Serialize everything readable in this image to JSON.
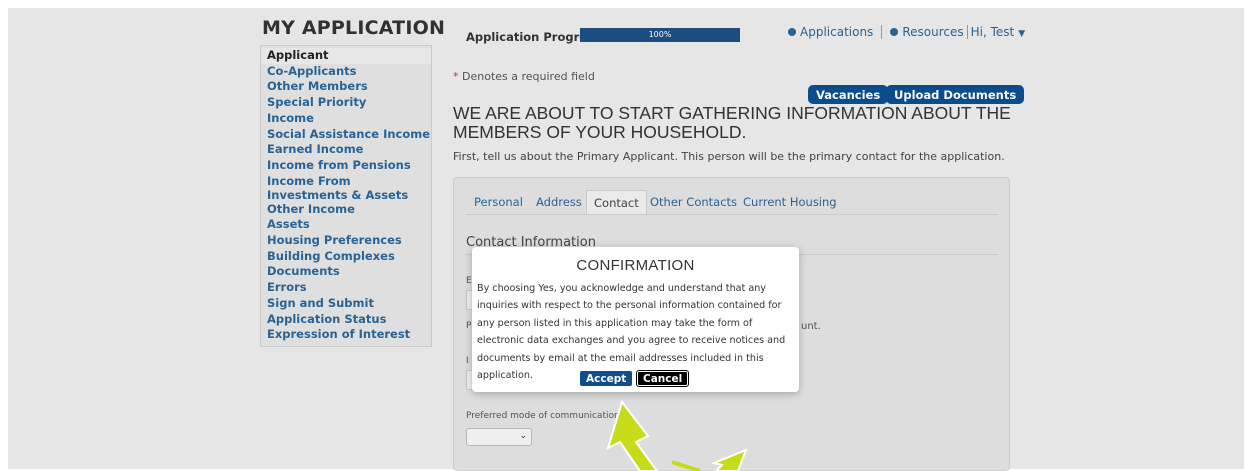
{
  "header": {
    "title": "MY APPLICATION",
    "progress_label": "Application Progress",
    "progress_value": 1.0,
    "progress_text": "100%",
    "nav": {
      "applications": "Applications",
      "resources": "Resources",
      "user": "Hi, Test"
    }
  },
  "sidebar": {
    "items": [
      {
        "label": "Applicant"
      },
      {
        "label": "Co-Applicants"
      },
      {
        "label": "Other Members"
      },
      {
        "label": "Special Priority"
      },
      {
        "label": "Income"
      },
      {
        "label": "Social Assistance Income"
      },
      {
        "label": "Earned Income"
      },
      {
        "label": "Income from Pensions"
      },
      {
        "label": "Income From Investments & Assets"
      },
      {
        "label": "Other Income"
      },
      {
        "label": "Assets"
      },
      {
        "label": "Housing Preferences"
      },
      {
        "label": "Building Complexes"
      },
      {
        "label": "Documents"
      },
      {
        "label": "Errors"
      },
      {
        "label": "Sign and Submit"
      },
      {
        "label": "Application Status"
      },
      {
        "label": "Expression of Interest"
      }
    ]
  },
  "main": {
    "required_star": "*",
    "required_note": "Denotes a required field",
    "vacancies_label": "Vacancies",
    "upload_label": "Upload Documents",
    "heading": "WE ARE ABOUT TO START GATHERING INFORMATION ABOUT THE MEMBERS OF YOUR HOUSEHOLD.",
    "intro": "First, tell us about the Primary Applicant. This person will be the primary contact for the application.",
    "tabs": [
      {
        "label": "Personal"
      },
      {
        "label": "Address"
      },
      {
        "label": "Contact"
      },
      {
        "label": "Other Contacts"
      },
      {
        "label": "Current Housing"
      }
    ],
    "section_title": "Contact Information",
    "frag_e": "E",
    "frag_p": "P",
    "frag_unt": "unt.",
    "frag_i": "I",
    "preferred_label": "Preferred mode of communication",
    "preferred_value": ""
  },
  "modal": {
    "title": "CONFIRMATION",
    "body": "By choosing Yes, you acknowledge and understand that any inquiries with respect to the personal information contained for any person listed in this application may take the form of electronic data exchanges and you agree to receive notices and documents by email at the email addresses included in this application.",
    "accept_label": "Accept",
    "cancel_label": "Cancel"
  },
  "colors": {
    "brand_blue": "#0e4e8e",
    "link_blue": "#2b6596",
    "arrow": "#c6dc1a"
  }
}
